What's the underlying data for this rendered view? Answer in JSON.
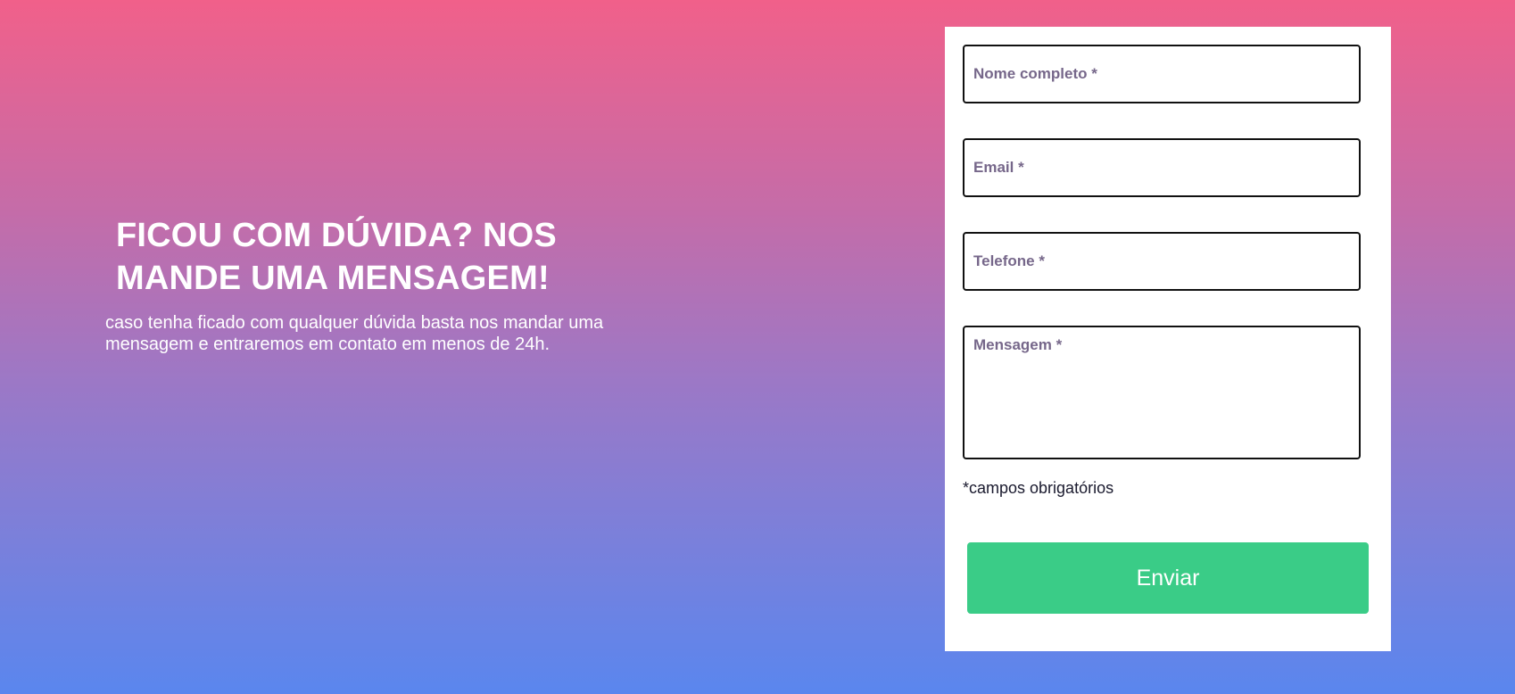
{
  "hero": {
    "title": "FICOU COM DÚVIDA? NOS MANDE UMA MENSAGEM!",
    "subtitle": "caso tenha ficado com qualquer dúvida basta nos mandar uma mensagem e entraremos em contato em menos de 24h."
  },
  "form": {
    "name_placeholder": "Nome completo *",
    "email_placeholder": "Email *",
    "phone_placeholder": "Telefone *",
    "message_placeholder": "Mensagem *",
    "required_note": "*campos obrigatórios",
    "submit_label": "Enviar"
  },
  "colors": {
    "gradient_top": "#f1608a",
    "gradient_bottom": "#5a86ee",
    "button": "#3acc87",
    "placeholder": "#76678a"
  }
}
